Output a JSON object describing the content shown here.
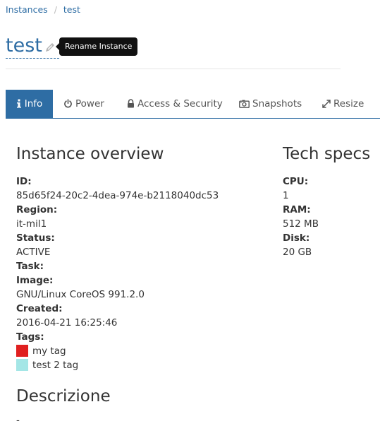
{
  "breadcrumb": {
    "parent": "Instances",
    "separator": "/",
    "current": "test"
  },
  "title": "test",
  "tooltip": "Rename Instance",
  "tabs": [
    {
      "label": "Info",
      "icon": "info-icon",
      "active": true
    },
    {
      "label": "Power",
      "icon": "power-icon",
      "active": false
    },
    {
      "label": "Access & Security",
      "icon": "lock-icon",
      "active": false
    },
    {
      "label": "Snapshots",
      "icon": "camera-icon",
      "active": false
    },
    {
      "label": "Resize",
      "icon": "resize-icon",
      "active": false
    }
  ],
  "overview": {
    "heading": "Instance overview",
    "id_label": "ID:",
    "id_value": "85d65f24-20c2-4dea-974e-b2118040dc53",
    "region_label": "Region:",
    "region_value": "it-mil1",
    "status_label": "Status:",
    "status_value": "ACTIVE",
    "task_label": "Task:",
    "image_label": "Image:",
    "image_value": "GNU/Linux CoreOS 991.2.0",
    "created_label": "Created:",
    "created_value": "2016-04-21 16:25:46",
    "tags_label": "Tags:",
    "tags": [
      {
        "name": "my tag",
        "color": "#e02020"
      },
      {
        "name": "test 2 tag",
        "color": "#a4e6e6"
      }
    ]
  },
  "specs": {
    "heading": "Tech specs",
    "cpu_label": "CPU:",
    "cpu_value": "1",
    "ram_label": "RAM:",
    "ram_value": "512 MB",
    "disk_label": "Disk:",
    "disk_value": "20 GB"
  },
  "description": {
    "heading": "Descrizione",
    "value": "-"
  },
  "colors": {
    "accent": "#2e6da4",
    "text": "#333333"
  }
}
